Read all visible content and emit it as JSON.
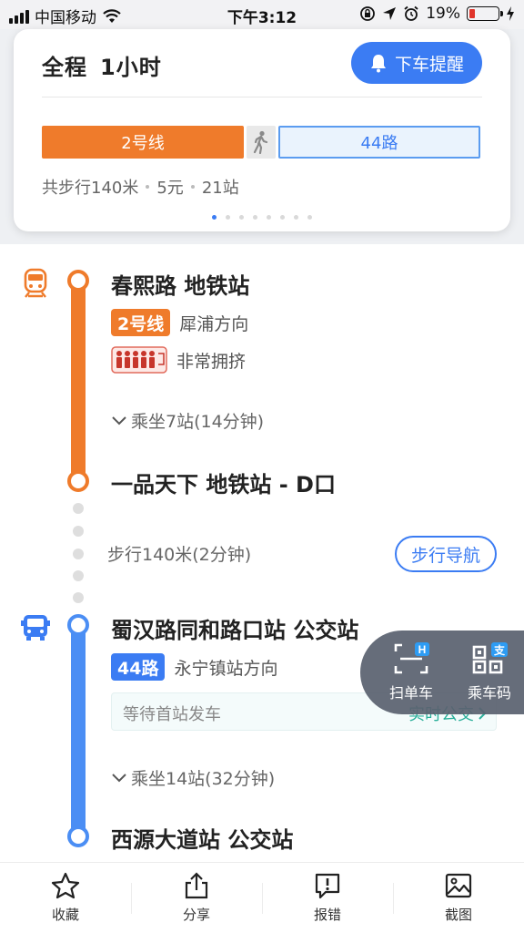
{
  "status_bar": {
    "carrier": "中国移动",
    "time": "下午3:12",
    "battery_percent": "19%",
    "battery_level": 0.19
  },
  "summary": {
    "label": "全程",
    "duration": "1小时",
    "remind_button": "下车提醒",
    "segments": {
      "metro": "2号线",
      "bus": "44路"
    },
    "meta": {
      "walk": "共步行140米",
      "fare": "5元",
      "stations": "21站"
    },
    "pager": {
      "total": 8,
      "active": 0
    }
  },
  "metro_leg": {
    "start_stop": "春熙路 地铁站",
    "line_badge": "2号线",
    "direction": "犀浦方向",
    "crowd": "非常拥挤",
    "ride_info": "乘坐7站(14分钟)",
    "end_stop": "一品天下 地铁站 - D口"
  },
  "walk_leg": {
    "text": "步行140米(2分钟)",
    "nav_button": "步行导航"
  },
  "bus_leg": {
    "start_stop": "蜀汉路同和路口站 公交站",
    "line_badge": "44路",
    "direction": "永宁镇站方向",
    "wait_text": "等待首站发车",
    "realtime_link": "实时公交",
    "ride_info": "乘坐14站(32分钟)",
    "end_stop": "西源大道站 公交站"
  },
  "float_panel": {
    "scan_label": "扫单车",
    "code_label": "乘车码",
    "code_badge": "支"
  },
  "toolbar": {
    "items": [
      {
        "label": "收藏",
        "icon": "star-icon"
      },
      {
        "label": "分享",
        "icon": "share-icon"
      },
      {
        "label": "报错",
        "icon": "report-icon"
      },
      {
        "label": "截图",
        "icon": "screenshot-icon"
      }
    ]
  },
  "colors": {
    "metro": "#ef7b2b",
    "bus": "#3b7cf3",
    "realtime": "#2aaf9a"
  }
}
